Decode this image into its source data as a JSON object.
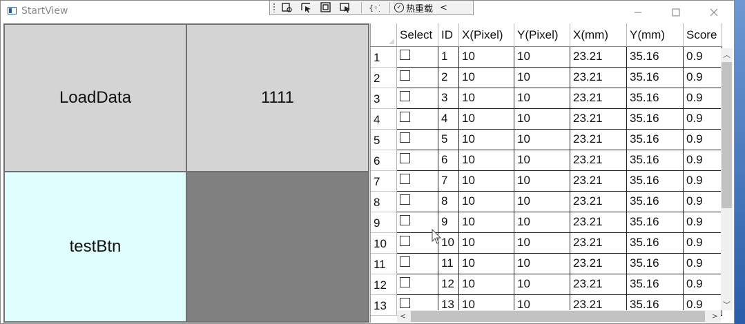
{
  "window": {
    "title": "StartView"
  },
  "hot_toolbar": {
    "hot_reload_label": "热重载",
    "collapse_glyph": "<"
  },
  "window_controls": {
    "minimize": "—",
    "maximize": "☐",
    "close": "✕"
  },
  "buttons": {
    "load_data": "LoadData",
    "btn_1111": "1111",
    "test_btn": "testBtn"
  },
  "grid": {
    "columns": [
      "Select",
      "ID",
      "X(Pixel)",
      "Y(Pixel)",
      "X(mm)",
      "Y(mm)",
      "Score"
    ],
    "rows": [
      {
        "rh": "1",
        "id": "1",
        "xp": "10",
        "yp": "10",
        "xmm": "23.21",
        "ymm": "35.16",
        "score": "0.9"
      },
      {
        "rh": "2",
        "id": "2",
        "xp": "10",
        "yp": "10",
        "xmm": "23.21",
        "ymm": "35.16",
        "score": "0.9"
      },
      {
        "rh": "3",
        "id": "3",
        "xp": "10",
        "yp": "10",
        "xmm": "23.21",
        "ymm": "35.16",
        "score": "0.9"
      },
      {
        "rh": "4",
        "id": "4",
        "xp": "10",
        "yp": "10",
        "xmm": "23.21",
        "ymm": "35.16",
        "score": "0.9"
      },
      {
        "rh": "5",
        "id": "5",
        "xp": "10",
        "yp": "10",
        "xmm": "23.21",
        "ymm": "35.16",
        "score": "0.9"
      },
      {
        "rh": "6",
        "id": "6",
        "xp": "10",
        "yp": "10",
        "xmm": "23.21",
        "ymm": "35.16",
        "score": "0.9"
      },
      {
        "rh": "7",
        "id": "7",
        "xp": "10",
        "yp": "10",
        "xmm": "23.21",
        "ymm": "35.16",
        "score": "0.9"
      },
      {
        "rh": "8",
        "id": "8",
        "xp": "10",
        "yp": "10",
        "xmm": "23.21",
        "ymm": "35.16",
        "score": "0.9"
      },
      {
        "rh": "9",
        "id": "9",
        "xp": "10",
        "yp": "10",
        "xmm": "23.21",
        "ymm": "35.16",
        "score": "0.9"
      },
      {
        "rh": "10",
        "id": "10",
        "xp": "10",
        "yp": "10",
        "xmm": "23.21",
        "ymm": "35.16",
        "score": "0.9"
      },
      {
        "rh": "11",
        "id": "11",
        "xp": "10",
        "yp": "10",
        "xmm": "23.21",
        "ymm": "35.16",
        "score": "0.9"
      },
      {
        "rh": "12",
        "id": "12",
        "xp": "10",
        "yp": "10",
        "xmm": "23.21",
        "ymm": "35.16",
        "score": "0.9"
      },
      {
        "rh": "13",
        "id": "13",
        "xp": "10",
        "yp": "10",
        "xmm": "23.21",
        "ymm": "35.16",
        "score": "0.9"
      }
    ]
  },
  "colors": {
    "button_grey": "#d4d4d4",
    "button_cyan": "#e0fefe",
    "panel_grey": "#808080"
  }
}
